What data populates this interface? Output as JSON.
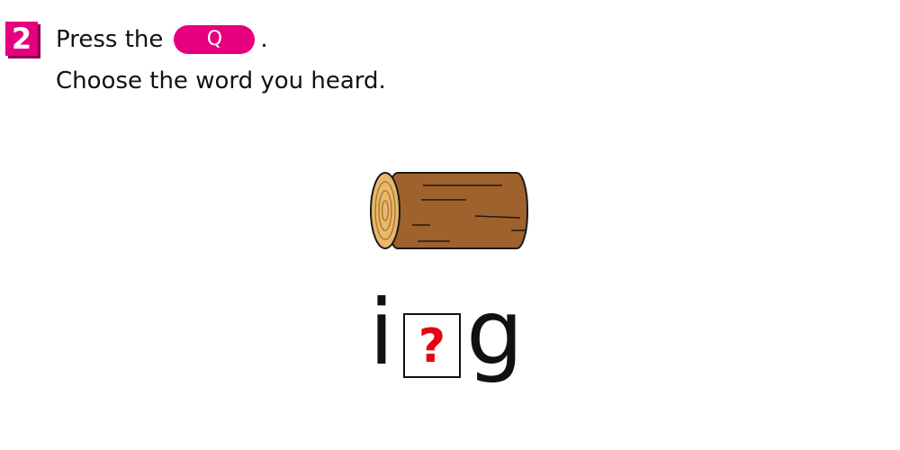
{
  "instruction": {
    "step_number": "2",
    "line1_prefix": "Press the",
    "button_label": "Q",
    "line1_suffix": ".",
    "line2": "Choose the word you heard."
  },
  "picture": {
    "icon": "log-icon",
    "colors": {
      "bark": "#a0622d",
      "wood_end": "#e8b96a",
      "outline": "#1a1a1a"
    }
  },
  "word": {
    "first_letter": "i",
    "missing_placeholder": "?",
    "last_letter": "g"
  },
  "colors": {
    "accent": "#e4007f",
    "question_mark": "#e60012"
  }
}
